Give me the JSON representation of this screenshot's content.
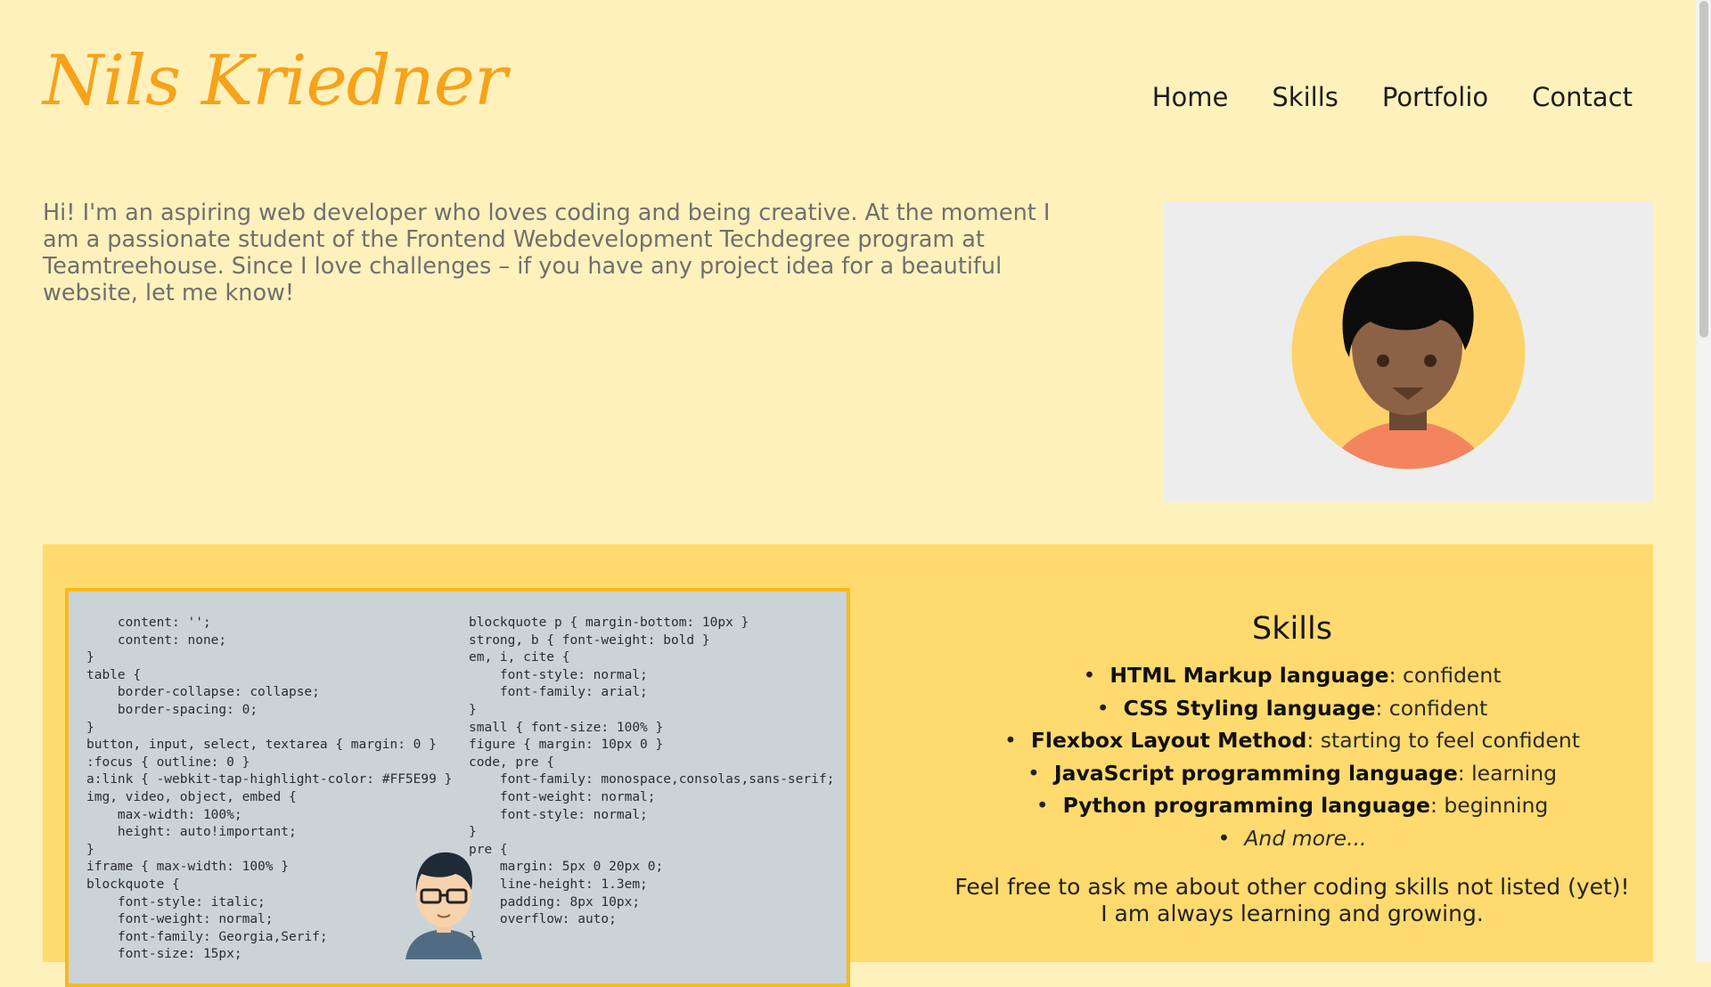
{
  "header": {
    "logo": "Nils Kriedner",
    "nav": [
      "Home",
      "Skills",
      "Portfolio",
      "Contact"
    ]
  },
  "intro": {
    "text": "Hi! I'm an aspiring web developer who loves coding and being creative. At the moment I am a passionate student of the Frontend Webdevelopment Techdegree program at Teamtreehouse. Since I love challenges – if you have any project idea for a beautiful website, let me know!"
  },
  "skills": {
    "title": "Skills",
    "items": [
      {
        "name": "HTML Markup language",
        "level": ": confident"
      },
      {
        "name": "CSS Styling language",
        "level": ": confident"
      },
      {
        "name": "Flexbox Layout Method",
        "level": ": starting to feel confident"
      },
      {
        "name": "JavaScript programming language",
        "level": ": learning"
      },
      {
        "name": "Python programming language",
        "level": ": beginning"
      }
    ],
    "more": "And more...",
    "note": "Feel free to ask me about other coding skills not listed (yet)! I am always learning and growing."
  },
  "code_image": {
    "left": "    content: '';\n    content: none;\n}\ntable {\n    border-collapse: collapse;\n    border-spacing: 0;\n}\nbutton, input, select, textarea { margin: 0 }\n:focus { outline: 0 }\na:link { -webkit-tap-highlight-color: #FF5E99 }\nimg, video, object, embed {\n    max-width: 100%;\n    height: auto!important;\n}\niframe { max-width: 100% }\nblockquote {\n    font-style: italic;\n    font-weight: normal;\n    font-family: Georgia,Serif;\n    font-size: 15px;",
    "right": "blockquote p { margin-bottom: 10px }\nstrong, b { font-weight: bold }\nem, i, cite {\n    font-style: normal;\n    font-family: arial;\n}\nsmall { font-size: 100% }\nfigure { margin: 10px 0 }\ncode, pre {\n    font-family: monospace,consolas,sans-serif;\n    font-weight: normal;\n    font-style: normal;\n}\npre {\n    margin: 5px 0 20px 0;\n    line-height: 1.3em;\n    padding: 8px 10px;\n    overflow: auto;\n}\n{"
  },
  "colors": {
    "page_background": "#fff1bc",
    "accent": "#f6a21a",
    "skills_background": "#ffda6e",
    "avatar_circle": "#fdd26a",
    "avatar_shirt": "#f3845d"
  }
}
